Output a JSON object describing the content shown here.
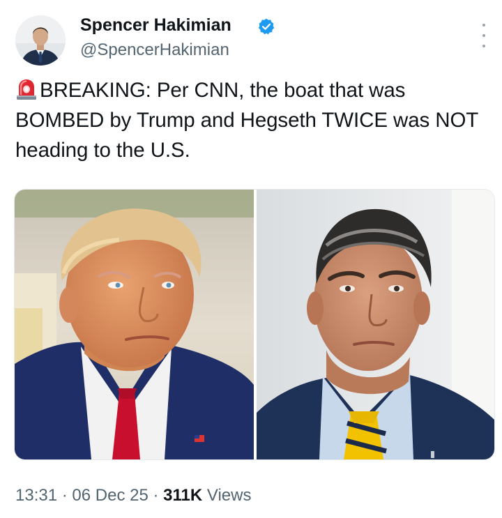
{
  "author": {
    "name": "Spencer Hakimian",
    "handle": "@SpencerHakimian",
    "verified": true,
    "verified_color": "#1d9bf0"
  },
  "tweet": {
    "emoji": "siren-icon",
    "text": "BREAKING: Per CNN, the boat that was BOMBED by Trump and Hegseth TWICE was NOT heading to the U.S."
  },
  "media": {
    "count": 2
  },
  "meta": {
    "time": "13:31",
    "date": "06 Dec 25",
    "separator": "·",
    "views_count": "311K",
    "views_label": "Views"
  },
  "colors": {
    "text": "#0f1419",
    "secondary": "#536471",
    "background": "#ffffff"
  }
}
